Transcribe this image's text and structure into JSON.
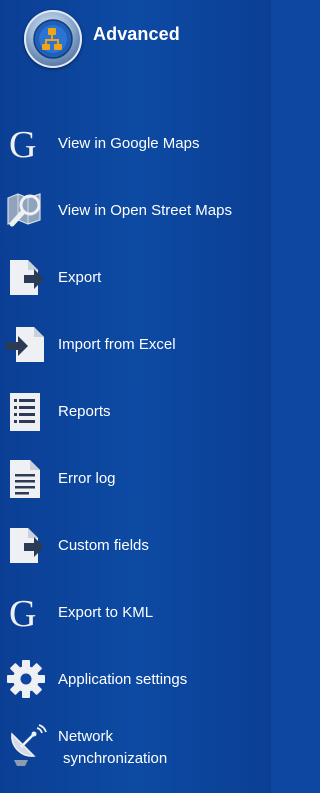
{
  "header": {
    "title": "Advanced",
    "logo_icon": "app-logo-icon"
  },
  "menu": {
    "items": [
      {
        "id": "google-maps",
        "label": "View in Google Maps",
        "icon": "google-g-icon"
      },
      {
        "id": "open-street-maps",
        "label": "View in Open Street Maps",
        "icon": "map-magnifier-icon"
      },
      {
        "id": "export",
        "label": "Export",
        "icon": "export-document-icon"
      },
      {
        "id": "import-excel",
        "label": "Import from Excel",
        "icon": "import-document-icon"
      },
      {
        "id": "reports",
        "label": "Reports",
        "icon": "report-document-icon"
      },
      {
        "id": "error-log",
        "label": "Error log",
        "icon": "log-document-icon"
      },
      {
        "id": "custom-fields",
        "label": "Custom fields",
        "icon": "custom-fields-document-icon"
      },
      {
        "id": "export-kml",
        "label": "Export to KML",
        "icon": "google-g-icon"
      },
      {
        "id": "app-settings",
        "label": "Application settings",
        "icon": "gear-icon"
      },
      {
        "id": "network-sync",
        "label_line1": "Network",
        "label_line2": "synchronization",
        "icon": "satellite-dish-icon"
      }
    ]
  },
  "colors": {
    "background": "#0d47a1",
    "text": "#ffffff",
    "icon": "#eef0f3",
    "logo_accent": "#f2a316"
  }
}
